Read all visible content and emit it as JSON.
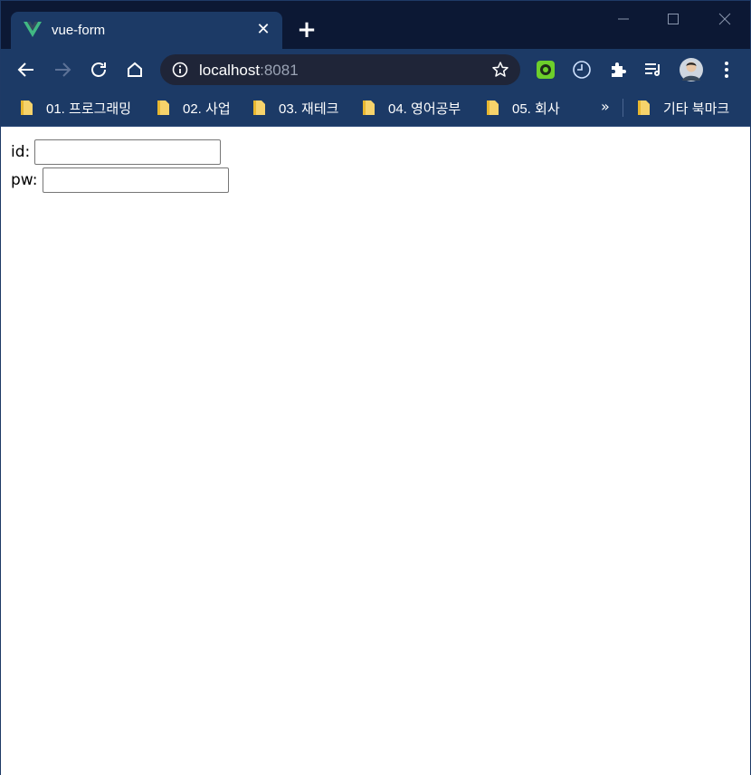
{
  "tab": {
    "title": "vue-form",
    "favicon": "vue-logo-icon"
  },
  "omnibox": {
    "host": "localhost",
    "port": ":8081"
  },
  "bookmarks": [
    {
      "label": "01. 프로그래밍"
    },
    {
      "label": "02. 사업"
    },
    {
      "label": "03. 재테크"
    },
    {
      "label": "04. 영어공부"
    },
    {
      "label": "05. 회사"
    }
  ],
  "bookmarks_more": "»",
  "other_bookmarks": "기타 북마크",
  "form": {
    "id_label": "id:",
    "id_value": "",
    "pw_label": "pw:",
    "pw_value": ""
  },
  "colors": {
    "tab_active": "#1c3a66",
    "titlebar": "#0c1834",
    "omnibox": "#1f2538",
    "vue_green": "#41b883",
    "vue_dark": "#34495e"
  }
}
